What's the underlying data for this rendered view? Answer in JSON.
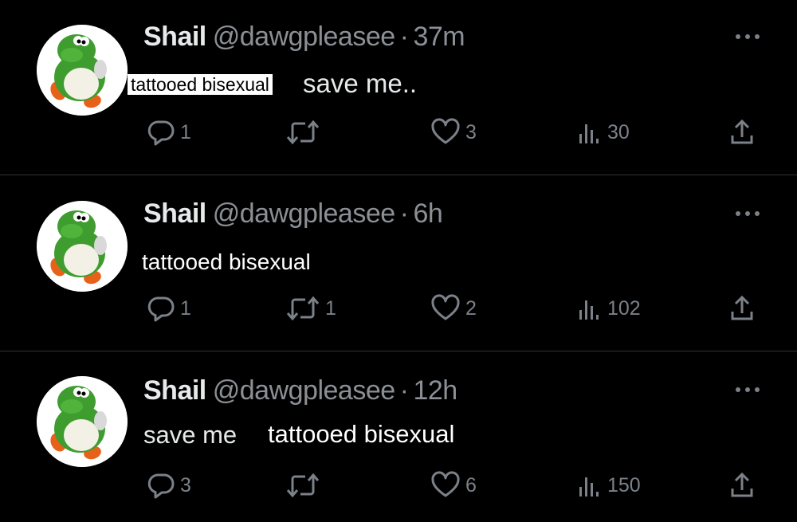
{
  "tweets": [
    {
      "display_name": "Shail",
      "handle": "@dawgpleasee",
      "separator": "·",
      "timestamp": "37m",
      "overlay_text": "tattooed bisexual",
      "original_text": "save me..",
      "replies": "1",
      "retweets": "",
      "likes": "3",
      "views": "30"
    },
    {
      "display_name": "Shail",
      "handle": "@dawgpleasee",
      "separator": "·",
      "timestamp": "6h",
      "overlay_text": "tattooed bisexual",
      "original_text": "",
      "replies": "1",
      "retweets": "1",
      "likes": "2",
      "views": "102"
    },
    {
      "display_name": "Shail",
      "handle": "@dawgpleasee",
      "separator": "·",
      "timestamp": "12h",
      "overlay_text": "tattooed bisexual",
      "original_text": "save me",
      "replies": "3",
      "retweets": "",
      "likes": "6",
      "views": "150"
    }
  ],
  "icons": {
    "avatar": "green-dinosaur-avatar",
    "more": "more-horizontal-icon",
    "reply": "reply-icon",
    "retweet": "retweet-icon",
    "like": "heart-icon",
    "views": "analytics-icon",
    "share": "share-icon"
  },
  "colors": {
    "background": "#000000",
    "text_primary": "#e7e9ea",
    "text_secondary": "#8b9096",
    "icon": "#7b8188",
    "divider": "#2f3336"
  }
}
